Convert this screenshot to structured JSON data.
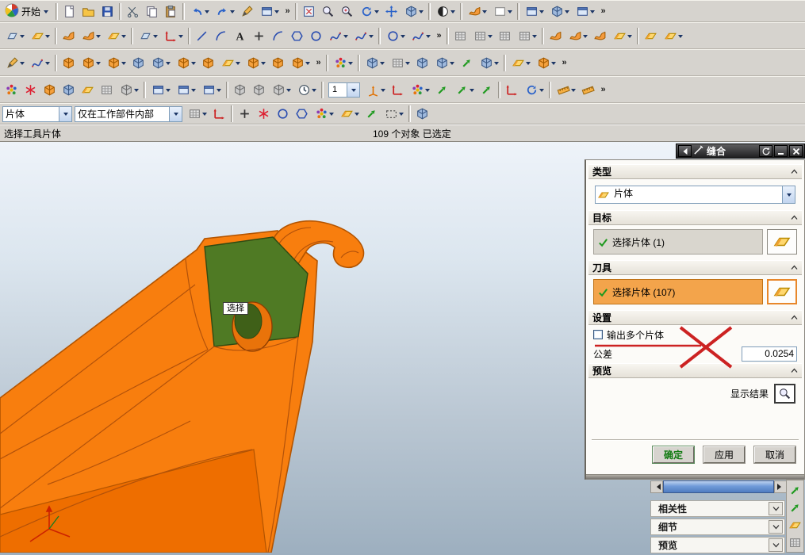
{
  "menus": {
    "start": "开始"
  },
  "view_combo": "1",
  "selection_bar": {
    "filter": "片体",
    "scope": "仅在工作部件内部"
  },
  "status": {
    "prompt": "选择工具片体",
    "selected": "109 个对象 已选定"
  },
  "tooltip": "选择",
  "dialog": {
    "title": "缝合",
    "type_section": {
      "label": "类型",
      "value": "片体"
    },
    "target_section": {
      "label": "目标",
      "select": "选择片体 (1)"
    },
    "tool_section": {
      "label": "刀具",
      "select": "选择片体 (107)"
    },
    "settings_section": {
      "label": "设置",
      "checkbox": "输出多个片体",
      "tolerance_label": "公差",
      "tolerance_value": "0.0254"
    },
    "preview_section": {
      "label": "预览",
      "show_result": "显示结果"
    },
    "buttons": {
      "ok": "确定",
      "apply": "应用",
      "cancel": "取消"
    }
  },
  "side_panels": [
    "相关性",
    "细节",
    "预览"
  ],
  "colors": {
    "accent_orange": "#f87e0e",
    "selection_orange": "#f3a44b",
    "face_green": "#4f7a24",
    "annotation_red": "#cc2222"
  },
  "toolbars": {
    "row1": [
      {
        "name": "new-file",
        "glyph": "doc"
      },
      {
        "name": "open-file",
        "glyph": "folder"
      },
      {
        "name": "save",
        "glyph": "disk"
      },
      {
        "sep": true
      },
      {
        "name": "cut",
        "glyph": "scissors"
      },
      {
        "name": "copy",
        "glyph": "copy"
      },
      {
        "name": "paste",
        "glyph": "paste"
      },
      {
        "sep": true
      },
      {
        "name": "undo",
        "glyph": "undo",
        "dd": true
      },
      {
        "name": "redo",
        "glyph": "redo",
        "dd": true
      },
      {
        "name": "command-pen",
        "glyph": "pen"
      },
      {
        "name": "window-display",
        "glyph": "window",
        "dd": true
      },
      {
        "name": "overflow-1",
        "glyph": "chev"
      },
      {
        "sep": true
      },
      {
        "name": "fit-view",
        "glyph": "window2"
      },
      {
        "name": "zoom-box",
        "glyph": "magnifier"
      },
      {
        "name": "zoom",
        "glyph": "magplus"
      },
      {
        "name": "rotate-view",
        "glyph": "rotate",
        "dd": true
      },
      {
        "name": "pan-view",
        "glyph": "pan"
      },
      {
        "name": "perspective-view",
        "glyph": "cubeB",
        "dd": true
      },
      {
        "sep": true
      },
      {
        "name": "render-style",
        "glyph": "sphere",
        "dd": true
      },
      {
        "sep": true
      },
      {
        "name": "face-analysis",
        "glyph": "surface",
        "dd": true
      },
      {
        "name": "background",
        "glyph": "whiterect",
        "dd": true
      },
      {
        "sep": true
      },
      {
        "name": "cascade-window",
        "glyph": "window",
        "dd": true
      },
      {
        "name": "new-window",
        "glyph": "cubeB",
        "dd": true
      },
      {
        "name": "arrange-window",
        "glyph": "window",
        "dd": true
      },
      {
        "name": "overflow-2",
        "glyph": "chev"
      }
    ],
    "row2": [
      {
        "name": "drawing-sheet",
        "glyph": "plane",
        "dd": true
      },
      {
        "name": "view-create",
        "glyph": "sheet",
        "dd": true
      },
      {
        "sep": true
      },
      {
        "name": "studio-surface",
        "glyph": "surface"
      },
      {
        "name": "swept-surface",
        "glyph": "surface",
        "dd": true
      },
      {
        "name": "sheet-from-curves",
        "glyph": "sheet",
        "dd": true
      },
      {
        "sep": true
      },
      {
        "name": "datum-plane",
        "glyph": "plane",
        "dd": true
      },
      {
        "name": "datum-axis",
        "glyph": "axesg",
        "dd": true
      },
      {
        "sep": true
      },
      {
        "name": "line-tool",
        "glyph": "lineg"
      },
      {
        "name": "arc-tool",
        "glyph": "arcg"
      },
      {
        "name": "text-tool",
        "glyph": "textA"
      },
      {
        "name": "point-tool",
        "glyph": "plusg"
      },
      {
        "name": "fillet-tool",
        "glyph": "arcg"
      },
      {
        "name": "polygon-tool",
        "glyph": "hexg"
      },
      {
        "name": "ellipse-tool",
        "glyph": "circg"
      },
      {
        "name": "conic-tool",
        "glyph": "spline",
        "dd": true
      },
      {
        "name": "spline-tool",
        "glyph": "spline",
        "dd": true
      },
      {
        "sep": true
      },
      {
        "name": "offset-curve",
        "glyph": "circg",
        "dd": true
      },
      {
        "name": "project-curve",
        "glyph": "spline",
        "dd": true
      },
      {
        "name": "overflow-3",
        "glyph": "chev"
      },
      {
        "sep": true
      },
      {
        "name": "mesh-surface-1",
        "glyph": "grid"
      },
      {
        "name": "mesh-surface-2",
        "glyph": "grid",
        "dd": true
      },
      {
        "name": "mesh-surface-3",
        "glyph": "grid"
      },
      {
        "name": "mesh-surface-4",
        "glyph": "grid",
        "dd": true
      },
      {
        "sep": true
      },
      {
        "name": "ruled-surface",
        "glyph": "surface"
      },
      {
        "name": "through-curves",
        "glyph": "surface",
        "dd": true
      },
      {
        "name": "sweep-surface",
        "glyph": "surface"
      },
      {
        "name": "section-surface",
        "glyph": "sheet",
        "dd": true
      },
      {
        "sep": true
      },
      {
        "name": "n-sided-surface",
        "glyph": "sheet"
      },
      {
        "name": "bounded-plane",
        "glyph": "sheet",
        "dd": true
      }
    ],
    "row3": [
      {
        "name": "sketch",
        "glyph": "pen",
        "dd": true
      },
      {
        "name": "sketch-curve",
        "glyph": "spline",
        "dd": true
      },
      {
        "sep": true
      },
      {
        "name": "extrude",
        "glyph": "cubeO"
      },
      {
        "name": "revolve",
        "glyph": "cubeO",
        "dd": true
      },
      {
        "name": "block",
        "glyph": "cubeO",
        "dd": true
      },
      {
        "name": "unite",
        "glyph": "cubeB"
      },
      {
        "name": "subtract",
        "glyph": "cubeB",
        "dd": true
      },
      {
        "name": "hole",
        "glyph": "cubeO",
        "dd": true
      },
      {
        "name": "shell",
        "glyph": "cubeO"
      },
      {
        "name": "chamfer",
        "glyph": "sheet",
        "dd": true
      },
      {
        "name": "edge-blend",
        "glyph": "cubeO",
        "dd": true
      },
      {
        "name": "taper",
        "glyph": "cubeO"
      },
      {
        "name": "thread",
        "glyph": "cubeO",
        "dd": true
      },
      {
        "name": "overflow-4",
        "glyph": "chev"
      },
      {
        "sep": true
      },
      {
        "name": "color-rosette",
        "glyph": "flower",
        "dd": true
      },
      {
        "sep": true
      },
      {
        "name": "wave-link",
        "glyph": "cubeB",
        "dd": true
      },
      {
        "name": "pattern-feature",
        "glyph": "grid",
        "dd": true
      },
      {
        "name": "mirror-feature",
        "glyph": "cubeB"
      },
      {
        "name": "promote-body",
        "glyph": "cubeB",
        "dd": true
      },
      {
        "name": "offset-face",
        "glyph": "arrget"
      },
      {
        "name": "scale-body",
        "glyph": "cubeB",
        "dd": true
      },
      {
        "sep": true
      },
      {
        "name": "trim-body",
        "glyph": "sheet",
        "dd": true
      },
      {
        "name": "split-body",
        "glyph": "cubeO",
        "dd": true
      },
      {
        "name": "overflow-5",
        "glyph": "chev"
      }
    ],
    "row4": [
      {
        "name": "snap-rosette",
        "glyph": "flower"
      },
      {
        "name": "snap-star",
        "glyph": "starr"
      },
      {
        "name": "snap-solid",
        "glyph": "cubeO"
      },
      {
        "name": "snap-body",
        "glyph": "cubeB"
      },
      {
        "name": "snap-sheet",
        "glyph": "sheet"
      },
      {
        "name": "snap-grid-pt",
        "glyph": "grid"
      },
      {
        "name": "snap-more",
        "glyph": "cubeG",
        "dd": true
      },
      {
        "sep": true
      },
      {
        "name": "section-view",
        "glyph": "window",
        "dd": true
      },
      {
        "name": "clip-section",
        "glyph": "window",
        "dd": true
      },
      {
        "name": "edit-section",
        "glyph": "window",
        "dd": true
      },
      {
        "sep": true
      },
      {
        "name": "wireframe-1",
        "glyph": "cubeG"
      },
      {
        "name": "wireframe-2",
        "glyph": "cubeG"
      },
      {
        "name": "wireframe-3",
        "glyph": "cubeG",
        "dd": true
      },
      {
        "name": "delay-update",
        "glyph": "clock",
        "dd": true
      },
      {
        "sep": true
      },
      {
        "combo": true,
        "name": "view-layer-combo"
      },
      {
        "name": "wcs",
        "glyph": "csys",
        "dd": true
      },
      {
        "name": "wcs-dynamics",
        "glyph": "axesg"
      },
      {
        "name": "snap-key",
        "glyph": "flower",
        "dd": true
      },
      {
        "name": "nav-arrow-1",
        "glyph": "arrget"
      },
      {
        "name": "nav-arrow-2",
        "glyph": "arrget",
        "dd": true
      },
      {
        "name": "nav-arrow-3",
        "glyph": "arrget"
      },
      {
        "sep": true
      },
      {
        "name": "x-axis-tool",
        "glyph": "axesg"
      },
      {
        "name": "rotate-wcs",
        "glyph": "rotate",
        "dd": true
      },
      {
        "sep": true
      },
      {
        "name": "measure-distance",
        "glyph": "ruler",
        "dd": true
      },
      {
        "name": "measure-angle",
        "glyph": "ruler"
      },
      {
        "name": "overflow-6",
        "glyph": "chev"
      }
    ],
    "selection_icons": [
      {
        "name": "snap-grid",
        "glyph": "grid",
        "dd": true
      },
      {
        "name": "snap-wcs",
        "glyph": "axesg"
      },
      {
        "sep": true
      },
      {
        "name": "snap-endpoint",
        "glyph": "plusg"
      },
      {
        "name": "snap-midpoint",
        "glyph": "starr"
      },
      {
        "name": "snap-center",
        "glyph": "circg"
      },
      {
        "name": "snap-intersection",
        "glyph": "hexg"
      },
      {
        "name": "snap-quadrant",
        "glyph": "flower",
        "dd": true
      },
      {
        "name": "select-sheet",
        "glyph": "sheet",
        "dd": true
      },
      {
        "name": "snap-magnet",
        "glyph": "arrget"
      },
      {
        "name": "rect-select",
        "glyph": "dashrect",
        "dd": true
      },
      {
        "sep": true
      },
      {
        "name": "solid-preview",
        "glyph": "cubeB"
      }
    ],
    "right_strip": [
      {
        "name": "nav-up-1",
        "glyph": "arrget"
      },
      {
        "name": "nav-up-2",
        "glyph": "arrget"
      },
      {
        "name": "nav-sheet",
        "glyph": "sheet"
      },
      {
        "name": "nav-grid",
        "glyph": "grid"
      }
    ]
  }
}
